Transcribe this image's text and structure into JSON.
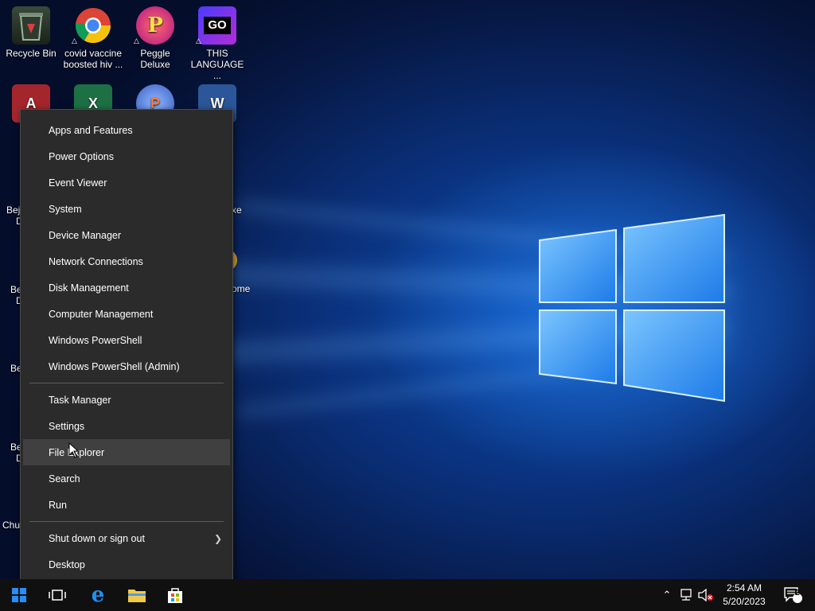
{
  "desktop": {
    "icons": [
      {
        "label": "Recycle Bin"
      },
      {
        "label": "covid vaccine boosted hiv ..."
      },
      {
        "label": "Peggle Deluxe"
      },
      {
        "label": "THIS LANGUAGE ..."
      }
    ],
    "partial_labels": [
      "Bej",
      "D",
      "xe",
      "Be",
      "D",
      "ome",
      "Be",
      "Be",
      "D",
      "Chuz"
    ]
  },
  "context_menu": {
    "items": [
      "Apps and Features",
      "Power Options",
      "Event Viewer",
      "System",
      "Device Manager",
      "Network Connections",
      "Disk Management",
      "Computer Management",
      "Windows PowerShell",
      "Windows PowerShell (Admin)",
      "Task Manager",
      "Settings",
      "File Explorer",
      "Search",
      "Run",
      "Shut down or sign out",
      "Desktop"
    ]
  },
  "taskbar": {
    "time": "2:54 AM",
    "date": "5/20/2023",
    "notification_count": "2",
    "accent": "#0078d7"
  }
}
